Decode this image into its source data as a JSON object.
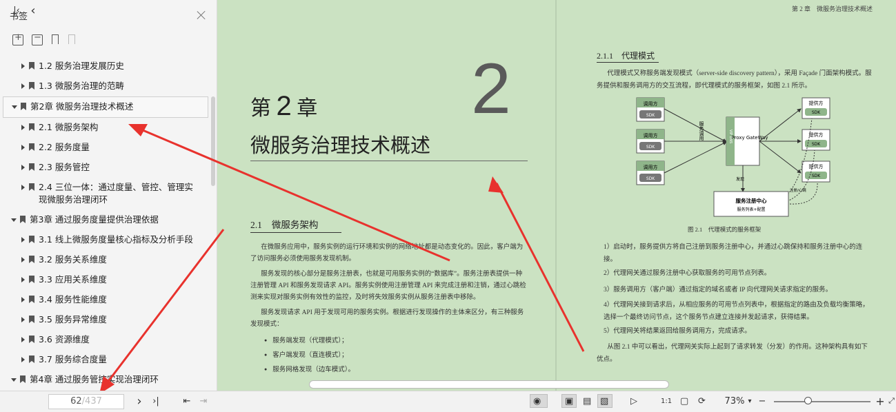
{
  "sidebar": {
    "title": "书签",
    "items": [
      {
        "label": "1.2  服务治理发展历史",
        "level": 2
      },
      {
        "label": "1.3  微服务治理的范畴",
        "level": 2
      },
      {
        "label": "第2章  微服务治理技术概述",
        "level": 1,
        "open": true,
        "selected": true
      },
      {
        "label": "2.1  微服务架构",
        "level": 2
      },
      {
        "label": "2.2  服务度量",
        "level": 2
      },
      {
        "label": "2.3  服务管控",
        "level": 2
      },
      {
        "label": "2.4  三位一体：通过度量、管控、管理实现微服务治理闭环",
        "level": 2
      },
      {
        "label": "第3章  通过服务度量提供治理依据",
        "level": 1,
        "open": true
      },
      {
        "label": "3.1  线上微服务度量核心指标及分析手段",
        "level": 2
      },
      {
        "label": "3.2  服务关系维度",
        "level": 2
      },
      {
        "label": "3.3  应用关系维度",
        "level": 2
      },
      {
        "label": "3.4  服务性能维度",
        "level": 2
      },
      {
        "label": "3.5  服务异常维度",
        "level": 2
      },
      {
        "label": "3.6  资源维度",
        "level": 2
      },
      {
        "label": "3.7  服务综合度量",
        "level": 2
      },
      {
        "label": "第4章  通过服务管控实现治理闭环",
        "level": 1,
        "open": true
      }
    ]
  },
  "left_page": {
    "big_number": "2",
    "chapter_prefix": "第",
    "chapter_number": "2",
    "chapter_suffix": "章",
    "chapter_title": "微服务治理技术概述",
    "section_number": "2.1",
    "section_title": "微服务架构",
    "para1": "在微服务应用中，服务实例的运行环境和实例的网络地址都是动态变化的。因此，客户端为了访问服务必须使用服务发现机制。",
    "para2": "服务发现的核心部分是服务注册表，也就是可用服务实例的“数据库”。服务注册表提供一种注册管理 API 和服务发现请求 API。服务实例使用注册管理 API 来完成注册和注销，通过心跳检测来实现对服务实例有效性的监控，及时将失效服务实例从服务注册表中移除。",
    "para3": "服务发现请求 API 用于发现可用的服务实例。根据进行发现操作的主体来区分，有三种服务发现模式：",
    "bullets": [
      "服务端发现（代理模式）；",
      "客户端发现（直连模式）；",
      "服务网格发现（边车模式）。"
    ]
  },
  "right_page": {
    "running_head": "第 2 章　微服务治理技术概述",
    "section": "2.1.1　代理模式",
    "intro": "代理模式又称服务端发现模式（server-side discovery pattern），采用 Façade 门面架构模式。服务提供和服务调用方的交互流程，即代理模式的服务框架，如图 2.1 所示。",
    "figure": {
      "caller": "调用方",
      "sdk": "SDK",
      "provider": "提供方",
      "proxy_side": "VIP DNS",
      "proxy": "Proxy GateWay",
      "call_label": "服务调用",
      "registry": "服务注册中心",
      "registry_sub": "服务列表+配置",
      "discover": "发现",
      "heartbeat": "注册/心跳"
    },
    "caption": "图 2.1　代理模式的服务框架",
    "steps": [
      "1）启动时，服务提供方将自己注册到服务注册中心，并通过心跳保持和服务注册中心的连接。",
      "2）代理网关通过服务注册中心获取服务的可用节点列表。",
      "3）服务调用方（客户端）通过指定的域名或者 IP 向代理网关请求指定的服务。",
      "4）代理网关接到请求后，从相应服务的可用节点列表中，根据指定的路由及负载均衡策略，选择一个最终访问节点，这个服务节点建立连接并发起请求，获得结果。",
      "5）代理网关将结果返回给服务调用方，完成请求。"
    ],
    "conclusion": "从图 2.1 中可以看出，代理网关实际上起到了请求转发（分发）的作用。这种架构具有如下优点。"
  },
  "toolbar": {
    "page_current": "62",
    "page_total": "/437",
    "zoom": "73%"
  },
  "colors": {
    "page_bg": "#cbe2c2",
    "annotation_arrow": "#e8322d"
  }
}
